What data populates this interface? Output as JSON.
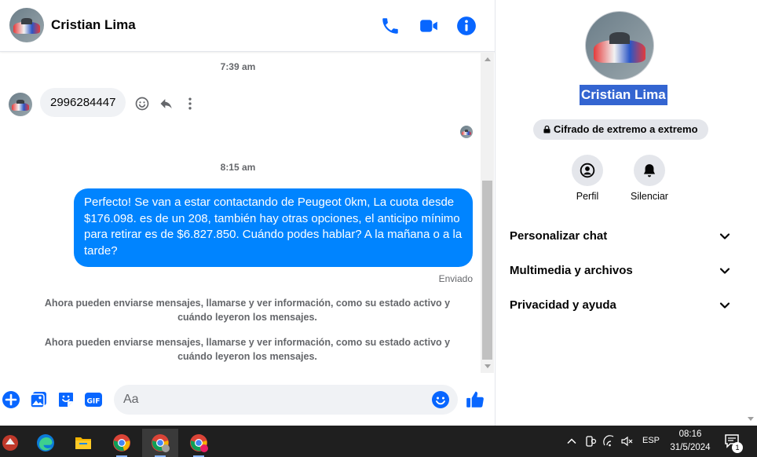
{
  "header": {
    "contact_name": "Cristian Lima",
    "icons": [
      "phone-icon",
      "video-icon",
      "info-icon"
    ]
  },
  "messages": {
    "time_1": "7:39 am",
    "incoming_text": "2996284447",
    "time_2": "8:15 am",
    "outgoing_text": "Perfecto!  Se van a estar contactando de Peugeot 0km, La cuota desde $176.098. es de un 208, también hay otras opciones, el anticipo mínimo para retirar es de $6.827.850. Cuándo podes hablar? A la mañana o a la tarde?",
    "status": "Enviado",
    "system_1": "Ahora pueden enviarse mensajes, llamarse y ver información, como su estado activo y cuándo leyeron los mensajes.",
    "system_2": "Ahora pueden enviarse mensajes, llamarse y ver información, como su estado activo y cuándo leyeron los mensajes."
  },
  "composer": {
    "placeholder": "Aa"
  },
  "info_panel": {
    "name": "Cristian Lima",
    "encryption": "Cifrado de extremo a extremo",
    "profile_label": "Perfil",
    "mute_label": "Silenciar",
    "sections": [
      "Personalizar chat",
      "Multimedia y archivos",
      "Privacidad y ayuda"
    ]
  },
  "taskbar": {
    "language": "ESP",
    "time": "08:16",
    "date": "31/5/2024",
    "notification_count": "1"
  },
  "colors": {
    "accent": "#0084ff",
    "messenger_blue": "#0866ff",
    "bubble_in": "#f0f2f5",
    "name_highlight": "#3465d1"
  }
}
